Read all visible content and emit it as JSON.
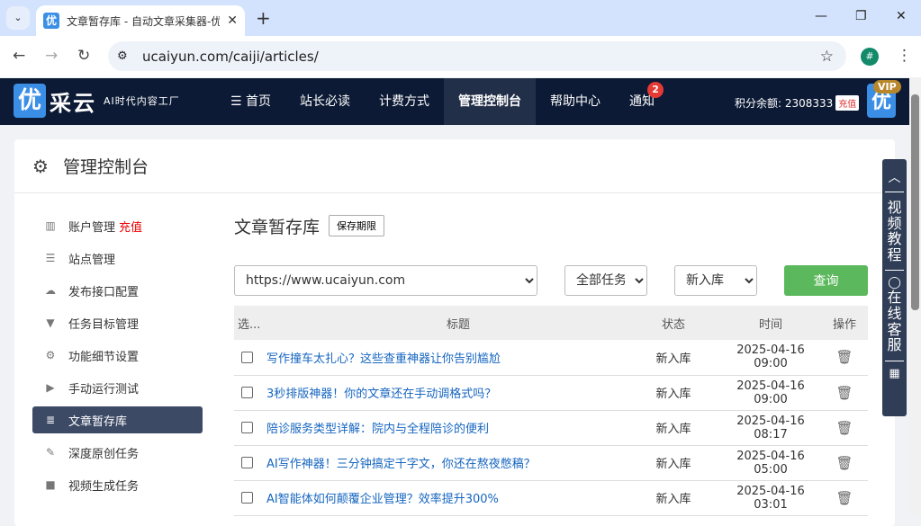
{
  "browser": {
    "tab_title": "文章暂存库 - 自动文章采集器-优",
    "favicon": "优",
    "url": "ucaiyun.com/caiji/articles/",
    "profile": "#"
  },
  "site": {
    "logo": "优",
    "logo_name": "采云",
    "slogan": "AI时代内容工厂",
    "nav": [
      "首页",
      "站长必读",
      "计费方式",
      "管理控制台",
      "帮助中心",
      "通知"
    ],
    "notify_count": "2",
    "balance": "积分余额: 2308333",
    "recharge": "充值",
    "vip": "VIP",
    "avatar": "优"
  },
  "panel": {
    "title": "管理控制台"
  },
  "sidebar": [
    {
      "label": "账户管理",
      "extra": "充值",
      "icon": "bar-chart"
    },
    {
      "label": "站点管理",
      "icon": "server"
    },
    {
      "label": "发布接口配置",
      "icon": "cloud-upload"
    },
    {
      "label": "任务目标管理",
      "icon": "filter"
    },
    {
      "label": "功能细节设置",
      "icon": "cogs"
    },
    {
      "label": "手动运行测试",
      "icon": "play-circle"
    },
    {
      "label": "文章暂存库",
      "icon": "database",
      "active": true
    },
    {
      "label": "深度原创任务",
      "icon": "edit"
    },
    {
      "label": "视频生成任务",
      "icon": "video"
    }
  ],
  "main": {
    "title": "文章暂存库",
    "keep_button": "保存期限",
    "site_select": "https://www.ucaiyun.com",
    "task_select": "全部任务",
    "status_select": "新入库",
    "query_button": "查询",
    "columns": [
      "选...",
      "标题",
      "状态",
      "时间",
      "操作"
    ],
    "rows": [
      {
        "title": "写作撞车太扎心？这些查重神器让你告别尴尬",
        "status": "新入库",
        "time": "2025-04-16 09:00"
      },
      {
        "title": "3秒排版神器！你的文章还在手动调格式吗？",
        "status": "新入库",
        "time": "2025-04-16 09:00"
      },
      {
        "title": "陪诊服务类型详解：院内与全程陪诊的便利",
        "status": "新入库",
        "time": "2025-04-16 08:17"
      },
      {
        "title": "AI写作神器！三分钟搞定千字文，你还在熬夜憋稿？",
        "status": "新入库",
        "time": "2025-04-16 05:00"
      },
      {
        "title": "AI智能体如何颠覆企业管理？效率提升300%",
        "status": "新入库",
        "time": "2025-04-16 03:01"
      }
    ]
  },
  "float": {
    "video": "视频教程",
    "service": "在线客服"
  },
  "colors": {
    "nav_bg": "#0c1a35",
    "active_sidebar": "#3d4a66",
    "query_green": "#5cb85c",
    "link": "#1565c0"
  }
}
